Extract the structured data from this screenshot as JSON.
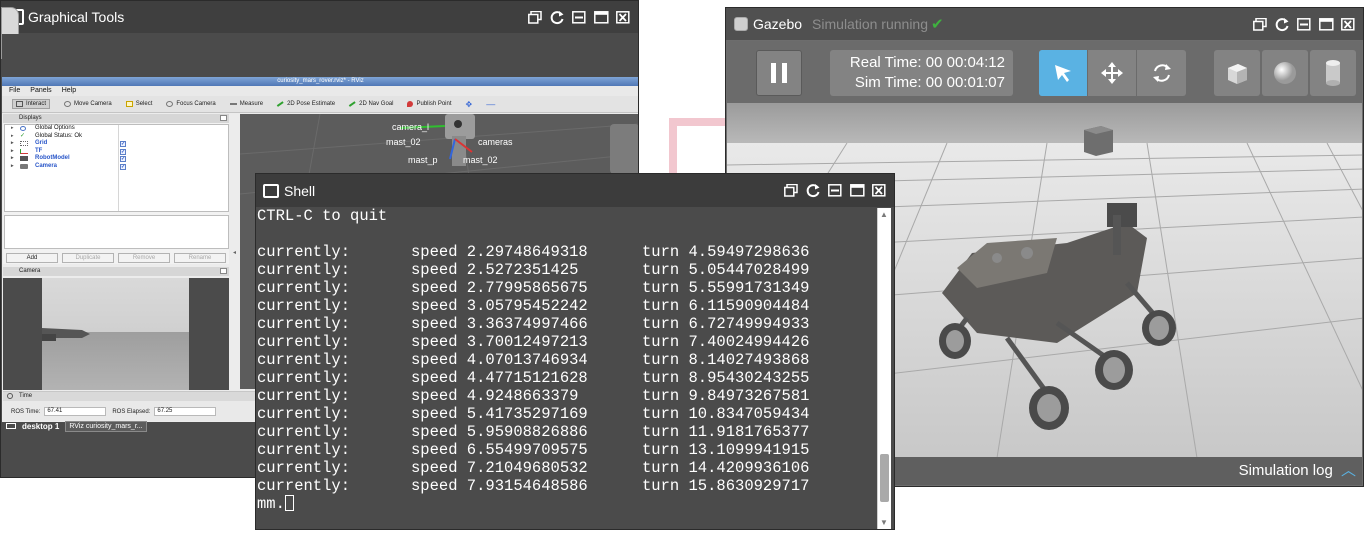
{
  "graphical_tools": {
    "title": "Graphical Tools",
    "rviz": {
      "window_title": "curiosity_mars_rover.rviz* - RViz",
      "menu": [
        "File",
        "Panels",
        "Help"
      ],
      "toolbar": [
        "Interact",
        "Move Camera",
        "Select",
        "Focus Camera",
        "Measure",
        "2D Pose Estimate",
        "2D Nav Goal",
        "Publish Point"
      ],
      "displays_title": "Displays",
      "tree": [
        {
          "label": "Global Options",
          "checked": null,
          "blue": false
        },
        {
          "label": "Global Status: Ok",
          "checked": null,
          "blue": false
        },
        {
          "label": "Grid",
          "checked": true,
          "blue": true
        },
        {
          "label": "TF",
          "checked": true,
          "blue": true
        },
        {
          "label": "RobotModel",
          "checked": true,
          "blue": true
        },
        {
          "label": "Camera",
          "checked": true,
          "blue": true
        }
      ],
      "buttons": [
        "Add",
        "Duplicate",
        "Remove",
        "Rename"
      ],
      "camera_panel_title": "Camera",
      "scene_labels": [
        "camera_l",
        "mast_02",
        "cameras",
        "mast_p",
        "mast_02"
      ],
      "time_panel_title": "Time",
      "ros_time_label": "ROS Time:",
      "ros_time_value": "67.41",
      "ros_elapsed_label": "ROS Elapsed:",
      "ros_elapsed_value": "67.25"
    },
    "taskbar": {
      "desktop": "desktop 1",
      "task": "RViz curiosity_mars_r..."
    }
  },
  "gazebo": {
    "title": "Gazebo",
    "status": "Simulation running",
    "real_time": "Real Time: 00 00:04:12",
    "sim_time": "Sim Time: 00 00:01:07",
    "sim_log": "Simulation log"
  },
  "shell": {
    "title": "Shell",
    "first_line": "CTRL-C to quit",
    "rows": [
      {
        "label": "currently:",
        "speed": "speed 2.29748649318",
        "turn": "turn 4.59497298636"
      },
      {
        "label": "currently:",
        "speed": "speed 2.5272351425",
        "turn": "turn 5.05447028499"
      },
      {
        "label": "currently:",
        "speed": "speed 2.77995865675",
        "turn": "turn 5.55991731349"
      },
      {
        "label": "currently:",
        "speed": "speed 3.05795452242",
        "turn": "turn 6.11590904484"
      },
      {
        "label": "currently:",
        "speed": "speed 3.36374997466",
        "turn": "turn 6.72749994933"
      },
      {
        "label": "currently:",
        "speed": "speed 3.70012497213",
        "turn": "turn 7.40024994426"
      },
      {
        "label": "currently:",
        "speed": "speed 4.07013746934",
        "turn": "turn 8.14027493868"
      },
      {
        "label": "currently:",
        "speed": "speed 4.47715121628",
        "turn": "turn 8.95430243255"
      },
      {
        "label": "currently:",
        "speed": "speed 4.9248663379",
        "turn": "turn 9.84973267581"
      },
      {
        "label": "currently:",
        "speed": "speed 5.41735297169",
        "turn": "turn 10.8347059434"
      },
      {
        "label": "currently:",
        "speed": "speed 5.95908826886",
        "turn": "turn 11.9181765377"
      },
      {
        "label": "currently:",
        "speed": "speed 6.55499709575",
        "turn": "turn 13.1099941915"
      },
      {
        "label": "currently:",
        "speed": "speed 7.21049680532",
        "turn": "turn 14.4209936106"
      },
      {
        "label": "currently:",
        "speed": "speed 7.93154648586",
        "turn": "turn 15.8630929717"
      }
    ],
    "prompt": "mm."
  }
}
